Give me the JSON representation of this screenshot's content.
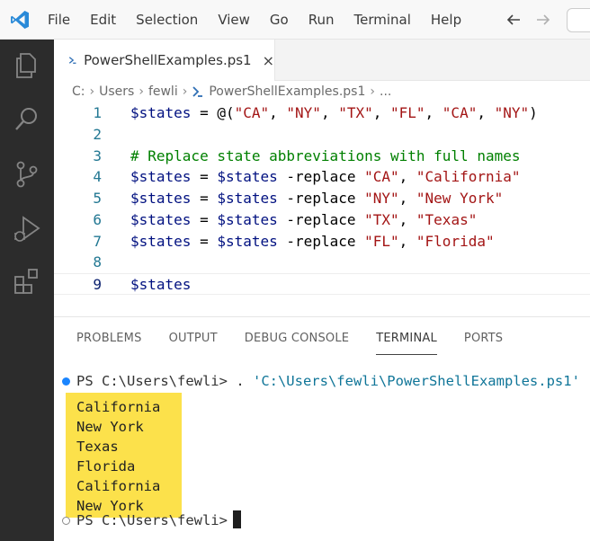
{
  "menu": [
    "File",
    "Edit",
    "Selection",
    "View",
    "Go",
    "Run",
    "Terminal",
    "Help"
  ],
  "tab": {
    "label": "PowerShellExamples.ps1",
    "close": "×"
  },
  "breadcrumb": [
    "C:",
    "Users",
    "fewli",
    "PowerShellExamples.ps1",
    "..."
  ],
  "editor": {
    "current_line": 9,
    "lines": [
      {
        "n": "1",
        "tokens": [
          {
            "t": "$states",
            "c": "var"
          },
          {
            "t": " = ",
            "c": "op"
          },
          {
            "t": "@(",
            "c": "op"
          },
          {
            "t": "\"CA\"",
            "c": "str"
          },
          {
            "t": ", ",
            "c": "op"
          },
          {
            "t": "\"NY\"",
            "c": "str"
          },
          {
            "t": ", ",
            "c": "op"
          },
          {
            "t": "\"TX\"",
            "c": "str"
          },
          {
            "t": ", ",
            "c": "op"
          },
          {
            "t": "\"FL\"",
            "c": "str"
          },
          {
            "t": ", ",
            "c": "op"
          },
          {
            "t": "\"CA\"",
            "c": "str"
          },
          {
            "t": ", ",
            "c": "op"
          },
          {
            "t": "\"NY\"",
            "c": "str"
          },
          {
            "t": ")",
            "c": "op"
          }
        ]
      },
      {
        "n": "2",
        "tokens": []
      },
      {
        "n": "3",
        "tokens": [
          {
            "t": "# Replace state abbreviations with full names",
            "c": "comment"
          }
        ]
      },
      {
        "n": "4",
        "tokens": [
          {
            "t": "$states",
            "c": "var"
          },
          {
            "t": " = ",
            "c": "op"
          },
          {
            "t": "$states",
            "c": "var"
          },
          {
            "t": " -replace ",
            "c": "op"
          },
          {
            "t": "\"CA\"",
            "c": "str"
          },
          {
            "t": ", ",
            "c": "op"
          },
          {
            "t": "\"California\"",
            "c": "str"
          }
        ]
      },
      {
        "n": "5",
        "tokens": [
          {
            "t": "$states",
            "c": "var"
          },
          {
            "t": " = ",
            "c": "op"
          },
          {
            "t": "$states",
            "c": "var"
          },
          {
            "t": " -replace ",
            "c": "op"
          },
          {
            "t": "\"NY\"",
            "c": "str"
          },
          {
            "t": ", ",
            "c": "op"
          },
          {
            "t": "\"New York\"",
            "c": "str"
          }
        ]
      },
      {
        "n": "6",
        "tokens": [
          {
            "t": "$states",
            "c": "var"
          },
          {
            "t": " = ",
            "c": "op"
          },
          {
            "t": "$states",
            "c": "var"
          },
          {
            "t": " -replace ",
            "c": "op"
          },
          {
            "t": "\"TX\"",
            "c": "str"
          },
          {
            "t": ", ",
            "c": "op"
          },
          {
            "t": "\"Texas\"",
            "c": "str"
          }
        ]
      },
      {
        "n": "7",
        "tokens": [
          {
            "t": "$states",
            "c": "var"
          },
          {
            "t": " = ",
            "c": "op"
          },
          {
            "t": "$states",
            "c": "var"
          },
          {
            "t": " -replace ",
            "c": "op"
          },
          {
            "t": "\"FL\"",
            "c": "str"
          },
          {
            "t": ", ",
            "c": "op"
          },
          {
            "t": "\"Florida\"",
            "c": "str"
          }
        ]
      },
      {
        "n": "8",
        "tokens": []
      },
      {
        "n": "9",
        "tokens": [
          {
            "t": "$states",
            "c": "var"
          }
        ]
      }
    ]
  },
  "panel": {
    "tabs": [
      "PROBLEMS",
      "OUTPUT",
      "DEBUG CONSOLE",
      "TERMINAL",
      "PORTS"
    ],
    "active_tab": "TERMINAL"
  },
  "terminal": {
    "prompt": "PS C:\\Users\\fewli>",
    "command_prefix": " . ",
    "command_path": "'C:\\Users\\fewli\\PowerShellExamples.ps1'",
    "output": [
      "California",
      "New York",
      "Texas",
      "Florida",
      "California",
      "New York"
    ],
    "highlight_color": "#fce14b"
  },
  "colors": {
    "activity_bar": "#2c2c2c",
    "accent": "#007acc",
    "string": "#a31515",
    "variable": "#001080",
    "comment": "#008000",
    "line_number": "#237893"
  }
}
